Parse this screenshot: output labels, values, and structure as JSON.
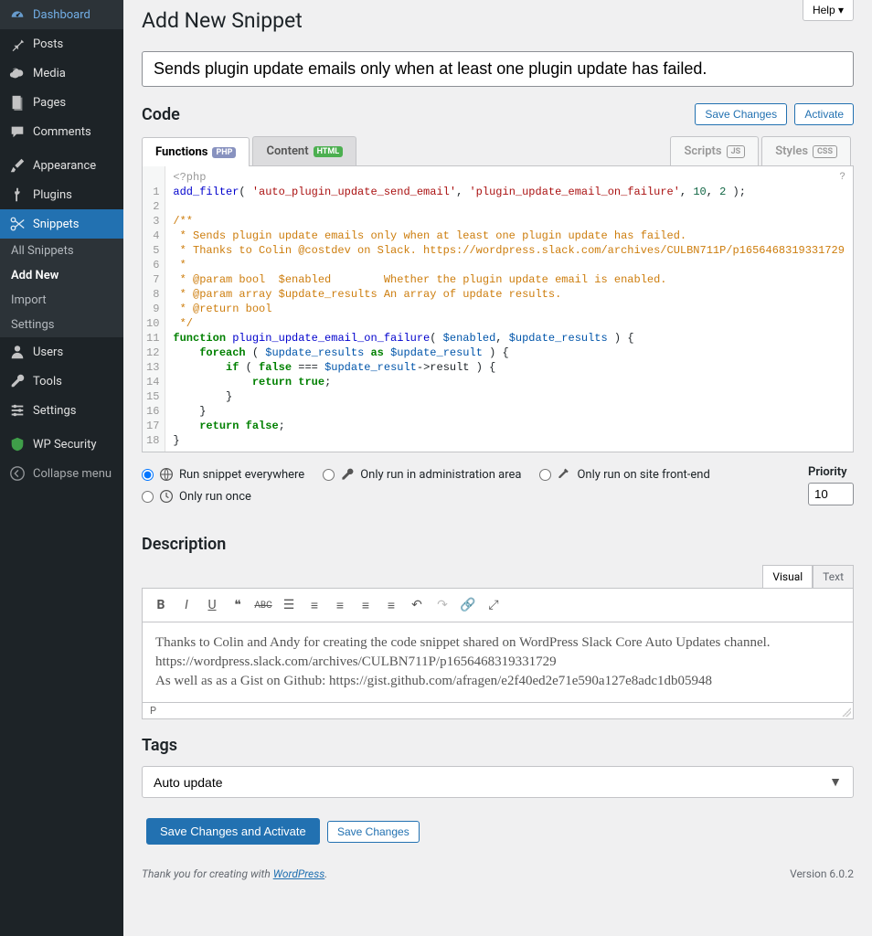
{
  "help_label": "Help ▾",
  "page_title": "Add New Snippet",
  "snippet_title": "Sends plugin update emails only when at least one plugin update has failed.",
  "sidebar": [
    {
      "icon": "dashboard",
      "label": "Dashboard"
    },
    {
      "icon": "pin",
      "label": "Posts"
    },
    {
      "icon": "media",
      "label": "Media"
    },
    {
      "icon": "page",
      "label": "Pages"
    },
    {
      "icon": "comment",
      "label": "Comments"
    },
    {
      "sep": true
    },
    {
      "icon": "brush",
      "label": "Appearance"
    },
    {
      "icon": "plug",
      "label": "Plugins"
    },
    {
      "icon": "scissors",
      "label": "Snippets",
      "active": true,
      "submenu": [
        {
          "label": "All Snippets"
        },
        {
          "label": "Add New",
          "active": true
        },
        {
          "label": "Import"
        },
        {
          "label": "Settings"
        }
      ]
    },
    {
      "icon": "user",
      "label": "Users"
    },
    {
      "icon": "tools",
      "label": "Tools"
    },
    {
      "icon": "settings",
      "label": "Settings"
    },
    {
      "sep": true
    },
    {
      "icon": "shield",
      "label": "WP Security",
      "tint": "#46b450"
    },
    {
      "icon": "collapse",
      "label": "Collapse menu",
      "muted": true
    }
  ],
  "code_heading": "Code",
  "save_changes": "Save Changes",
  "activate": "Activate",
  "tabs": {
    "functions": "Functions",
    "content": "Content",
    "scripts": "Scripts",
    "styles": "Styles"
  },
  "code_lines": [
    {
      "t": "php-open",
      "c": "<?php"
    },
    [
      {
        "t": "fn",
        "c": "add_filter"
      },
      {
        "t": "",
        "c": "( "
      },
      {
        "t": "str",
        "c": "'auto_plugin_update_send_email'"
      },
      {
        "t": "",
        "c": ", "
      },
      {
        "t": "str",
        "c": "'plugin_update_email_on_failure'"
      },
      {
        "t": "",
        "c": ", "
      },
      {
        "t": "num",
        "c": "10"
      },
      {
        "t": "",
        "c": ", "
      },
      {
        "t": "num",
        "c": "2"
      },
      {
        "t": "",
        "c": " );"
      }
    ],
    "",
    {
      "t": "comment",
      "c": "/**"
    },
    {
      "t": "comment",
      "c": " * Sends plugin update emails only when at least one plugin update has failed."
    },
    {
      "t": "comment",
      "c": " * Thanks to Colin @costdev on Slack. https://wordpress.slack.com/archives/CULBN711P/p1656468319331729"
    },
    {
      "t": "comment",
      "c": " *"
    },
    {
      "t": "comment",
      "c": " * @param bool  $enabled        Whether the plugin update email is enabled."
    },
    {
      "t": "comment",
      "c": " * @param array $update_results An array of update results."
    },
    {
      "t": "comment",
      "c": " * @return bool"
    },
    {
      "t": "comment",
      "c": " */"
    },
    [
      {
        "t": "kw",
        "c": "function"
      },
      {
        "t": "",
        "c": " "
      },
      {
        "t": "fn",
        "c": "plugin_update_email_on_failure"
      },
      {
        "t": "",
        "c": "( "
      },
      {
        "t": "var",
        "c": "$enabled"
      },
      {
        "t": "",
        "c": ", "
      },
      {
        "t": "var",
        "c": "$update_results"
      },
      {
        "t": "",
        "c": " ) {"
      }
    ],
    [
      {
        "t": "",
        "c": "    "
      },
      {
        "t": "kw",
        "c": "foreach"
      },
      {
        "t": "",
        "c": " ( "
      },
      {
        "t": "var",
        "c": "$update_results"
      },
      {
        "t": "",
        "c": " "
      },
      {
        "t": "kw",
        "c": "as"
      },
      {
        "t": "",
        "c": " "
      },
      {
        "t": "var",
        "c": "$update_result"
      },
      {
        "t": "",
        "c": " ) {"
      }
    ],
    [
      {
        "t": "",
        "c": "        "
      },
      {
        "t": "kw",
        "c": "if"
      },
      {
        "t": "",
        "c": " ( "
      },
      {
        "t": "kw",
        "c": "false"
      },
      {
        "t": "",
        "c": " "
      },
      {
        "t": "",
        "c": "==="
      },
      {
        "t": "",
        "c": " "
      },
      {
        "t": "var",
        "c": "$update_result"
      },
      {
        "t": "",
        "c": "->result ) {"
      }
    ],
    [
      {
        "t": "",
        "c": "            "
      },
      {
        "t": "kw",
        "c": "return"
      },
      {
        "t": "",
        "c": " "
      },
      {
        "t": "kw",
        "c": "true"
      },
      {
        "t": "",
        "c": ";"
      }
    ],
    {
      "t": "",
      "c": "        }"
    },
    {
      "t": "",
      "c": "    }"
    },
    [
      {
        "t": "",
        "c": "    "
      },
      {
        "t": "kw",
        "c": "return"
      },
      {
        "t": "",
        "c": " "
      },
      {
        "t": "kw",
        "c": "false"
      },
      {
        "t": "",
        "c": ";"
      }
    ],
    {
      "t": "",
      "c": "}"
    }
  ],
  "scope": {
    "everywhere": "Run snippet everywhere",
    "admin": "Only run in administration area",
    "frontend": "Only run on site front-end",
    "once": "Only run once",
    "selected": "everywhere"
  },
  "priority_label": "Priority",
  "priority_value": "10",
  "description_heading": "Description",
  "desc_tabs": {
    "visual": "Visual",
    "text": "Text"
  },
  "description_body": "Thanks to Colin and Andy for creating the code snippet shared on WordPress Slack Core Auto Updates channel.\nhttps://wordpress.slack.com/archives/CULBN711P/p1656468319331729\nAs well as as a Gist on Github: https://gist.github.com/afragen/e2f40ed2e71e590a127e8adc1db05948",
  "desc_status": "P",
  "tags_heading": "Tags",
  "tags_value": "Auto update",
  "save_and_activate": "Save Changes and Activate",
  "footer_thanks": "Thank you for creating with ",
  "footer_link": "WordPress",
  "footer_dot": ".",
  "version": "Version 6.0.2"
}
